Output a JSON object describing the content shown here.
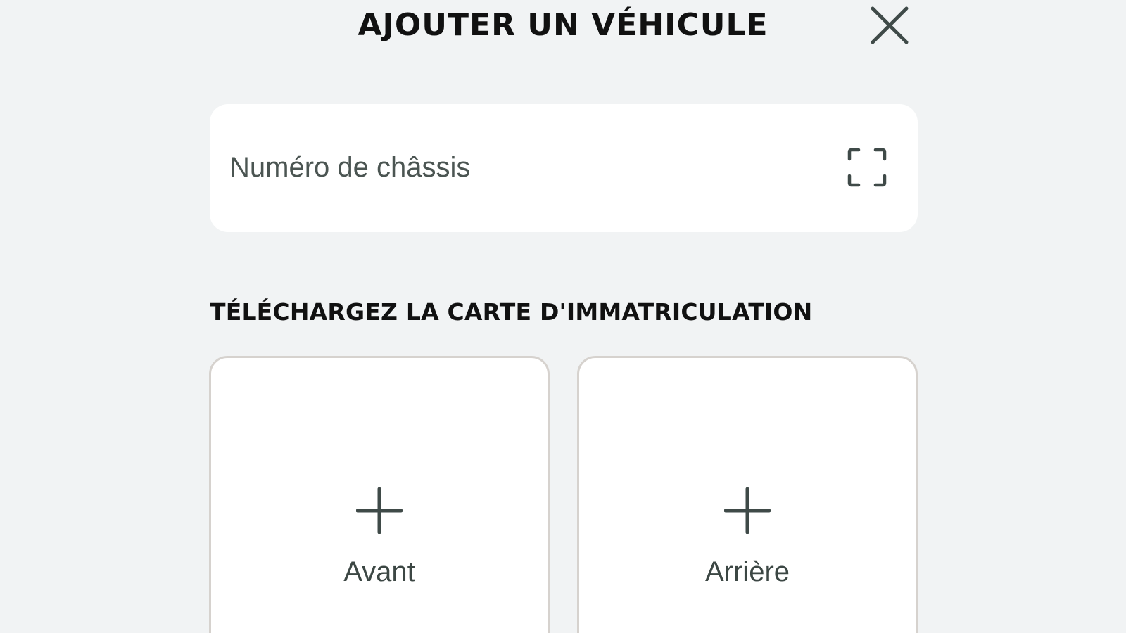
{
  "header": {
    "title": "AJOUTER UN VÉHICULE"
  },
  "icons": {
    "close": "close-icon",
    "scan": "scan-frame-icon",
    "add": "plus-icon"
  },
  "vin_field": {
    "placeholder": "Numéro de châssis",
    "value": ""
  },
  "upload_section": {
    "heading": "TÉLÉCHARGEZ LA CARTE D'IMMATRICULATION",
    "cards": [
      {
        "label": "Avant"
      },
      {
        "label": "Arrière"
      }
    ]
  },
  "colors": {
    "background": "#f1f3f4",
    "card": "#ffffff",
    "card_border": "#d6d2ce",
    "icon": "#3f4a48",
    "text_dark": "#111111",
    "text_muted": "#4b5552"
  }
}
